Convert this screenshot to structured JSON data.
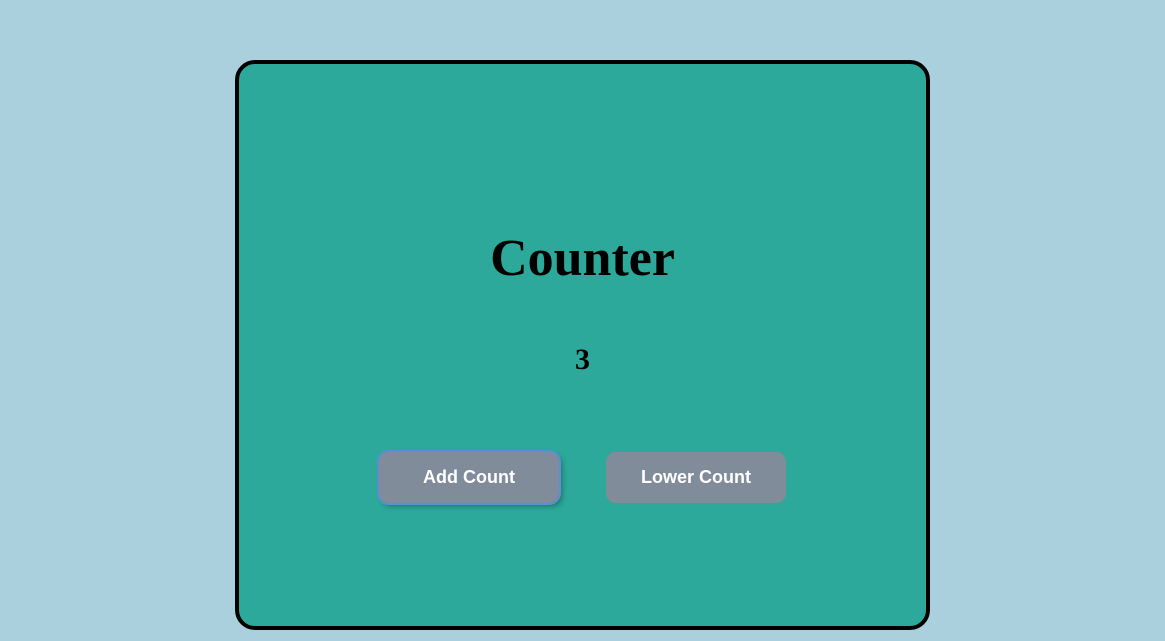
{
  "counter": {
    "title": "Counter",
    "value": "3",
    "buttons": {
      "add": "Add Count",
      "lower": "Lower Count"
    }
  }
}
